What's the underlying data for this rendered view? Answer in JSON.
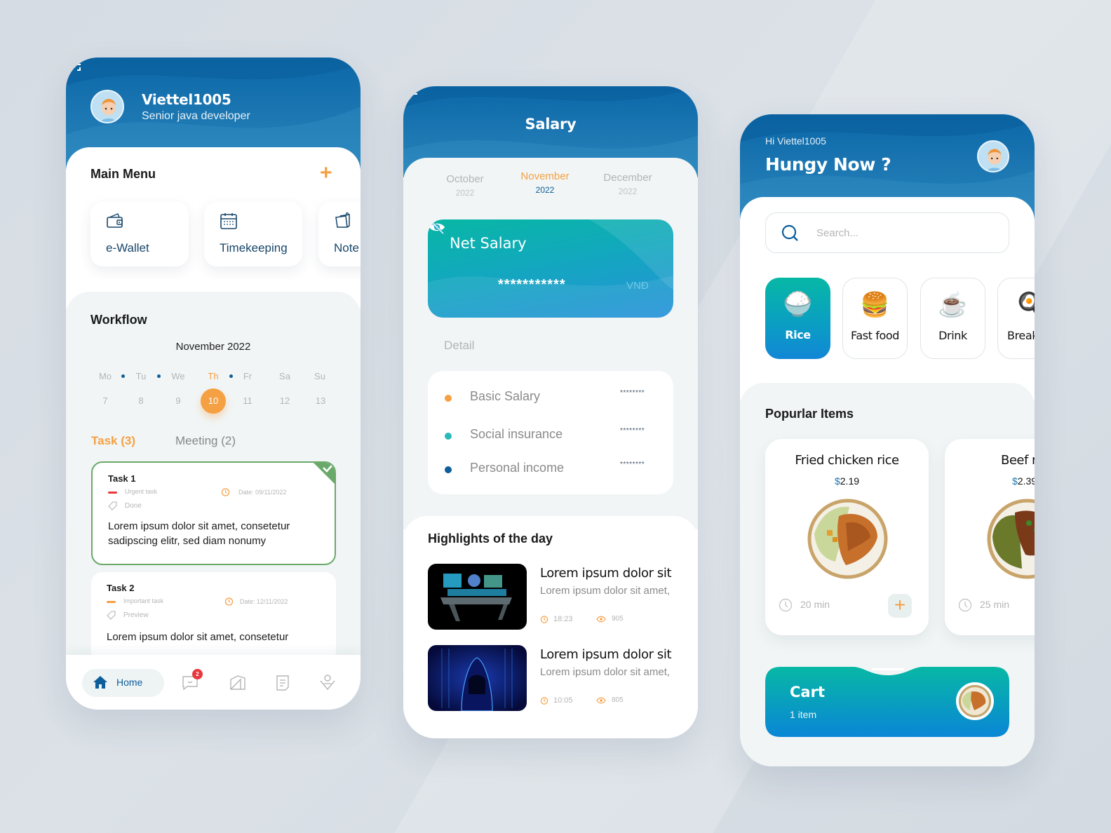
{
  "colors": {
    "primary_blue": "#0b67a8",
    "accent_orange": "#f5a043",
    "teal": "#08b7a4",
    "success_green": "#6aa96a",
    "urgent_red": "#e8383d",
    "background": "#d6dce3"
  },
  "workflow_app": {
    "user": {
      "name": "Viettel1005",
      "role": "Senior java developer",
      "avatar": "avatar-boy"
    },
    "scan_icon": "scan-icon",
    "main_menu": {
      "title": "Main Menu",
      "add_icon": "plus-icon",
      "items": [
        {
          "label": "e-Wallet",
          "icon": "wallet-icon"
        },
        {
          "label": "Timekeeping",
          "icon": "calendar-icon"
        },
        {
          "label": "Note",
          "icon": "note-icon"
        }
      ]
    },
    "workflow": {
      "title": "Workflow",
      "month": "November 2022",
      "weekdays": [
        "Mo",
        "Tu",
        "We",
        "Th",
        "Fr",
        "Sa",
        "Su"
      ],
      "days": [
        "7",
        "8",
        "9",
        "10",
        "11",
        "12",
        "13"
      ],
      "selected_day": "10",
      "dots_after": [
        "Mo",
        "Tu",
        "Th"
      ],
      "tabs": [
        {
          "label": "Task (3)",
          "active": true
        },
        {
          "label": "Meeting (2)",
          "active": false
        }
      ],
      "tasks": [
        {
          "title": "Task 1",
          "priority": "Urgent task",
          "priority_color": "#e8383d",
          "date": "Date: 09/11/2022",
          "status": "Done",
          "description": "Lorem ipsum dolor sit amet, consetetur sadipscing elitr, sed diam nonumy",
          "completed": true
        },
        {
          "title": "Task 2",
          "priority": "Important task",
          "priority_color": "#f5a043",
          "date": "Date: 12/11/2022",
          "status": "Preview",
          "description": "Lorem ipsum dolor sit amet, consetetur",
          "completed": false
        }
      ]
    },
    "bottom_nav": {
      "home_label": "Home",
      "message_badge": "2",
      "items": [
        "home-icon",
        "message-icon",
        "office-icon",
        "document-icon",
        "profile-icon"
      ]
    }
  },
  "salary_app": {
    "title": "Salary",
    "back_icon": "arrow-left-icon",
    "months": [
      {
        "month": "October",
        "year": "2022",
        "active": false
      },
      {
        "month": "November",
        "year": "2022",
        "active": true
      },
      {
        "month": "December",
        "year": "2022",
        "active": false
      }
    ],
    "net_salary": {
      "label": "Net Salary",
      "value": "***********",
      "currency": "VNĐ",
      "visibility_icon": "eye-off-icon"
    },
    "detail": {
      "title": "Detail",
      "rows": [
        {
          "label": "Basic Salary",
          "value": "********",
          "color": "#f5a043"
        },
        {
          "label": "Social insurance",
          "value": "********",
          "color": "#2cb8b8"
        },
        {
          "label": "Personal income",
          "value": "********",
          "color": "#0d5e9a"
        }
      ]
    },
    "highlights": {
      "title": "Highlights of the day",
      "items": [
        {
          "title": "Lorem ipsum dolor sit",
          "subtitle": "Lorem ipsum dolor sit amet,",
          "time": "18:23",
          "views": "905",
          "thumb": "control-desk-image"
        },
        {
          "title": "Lorem ipsum dolor sit",
          "subtitle": "Lorem ipsum dolor sit amet,",
          "time": "10:05",
          "views": "805",
          "thumb": "hacker-image"
        }
      ]
    }
  },
  "food_app": {
    "greeting": "Hi Viettel1005",
    "title": "Hungy Now ?",
    "search": {
      "placeholder": "Search...",
      "value": ""
    },
    "categories": [
      {
        "label": "Rice",
        "emoji": "🍚",
        "active": true
      },
      {
        "label": "Fast food",
        "emoji": "🍔",
        "active": false
      },
      {
        "label": "Drink",
        "emoji": "☕",
        "active": false
      },
      {
        "label": "Breakfast",
        "emoji": "🍳",
        "active": false
      }
    ],
    "popular": {
      "title": "Popurlar Items",
      "items": [
        {
          "name": "Fried chicken rice",
          "currency": "$",
          "price": "2.19",
          "time": "20 min"
        },
        {
          "name": "Beef rice",
          "currency": "$",
          "price": "2.39",
          "time": "25 min"
        }
      ]
    },
    "cart": {
      "title": "Cart",
      "count": "1 item"
    }
  }
}
